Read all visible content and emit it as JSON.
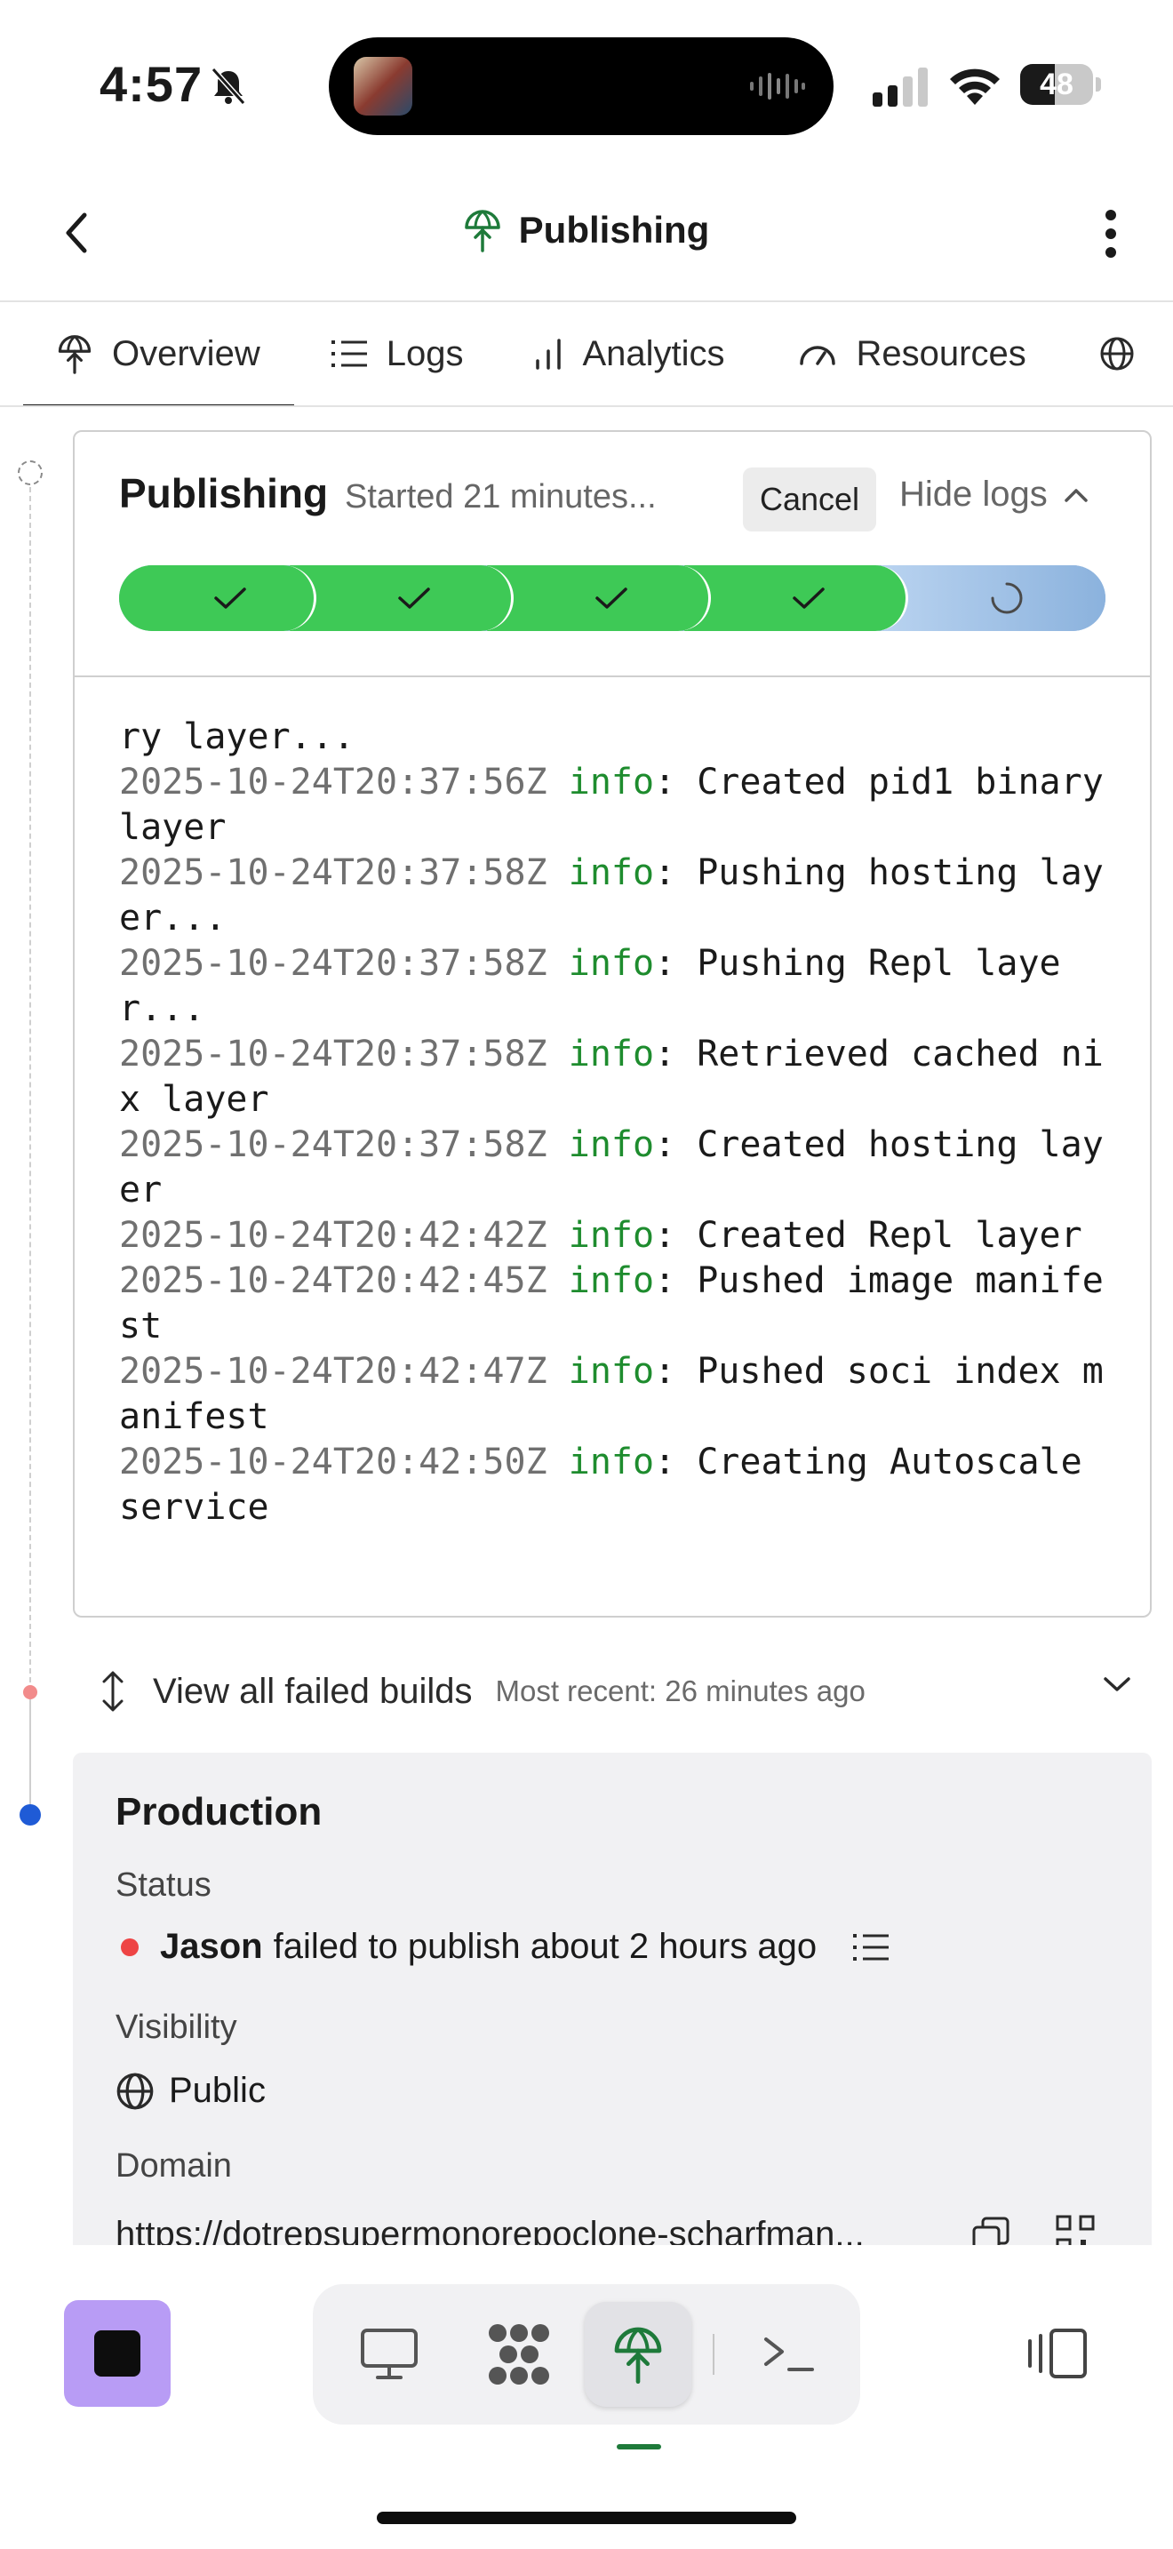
{
  "status_bar": {
    "time": "4:57",
    "battery_level": 48,
    "battery_label": "48"
  },
  "header": {
    "title": "Publishing"
  },
  "tabs": [
    {
      "label": "Overview",
      "icon": "publish-icon",
      "active": true
    },
    {
      "label": "Logs",
      "icon": "list-icon",
      "active": false
    },
    {
      "label": "Analytics",
      "icon": "bar-chart-icon",
      "active": false
    },
    {
      "label": "Resources",
      "icon": "gauge-icon",
      "active": false
    }
  ],
  "publishing": {
    "title": "Publishing",
    "started": "Started 21 minutes...",
    "cancel_label": "Cancel",
    "hide_logs_label": "Hide logs",
    "steps_completed": 4,
    "steps_total": 5
  },
  "logs": [
    {
      "ts": "",
      "level": "",
      "msg": "ry layer..."
    },
    {
      "ts": "2025-10-24T20:37:56Z",
      "level": "info",
      "msg": ": Created pid1 binary layer"
    },
    {
      "ts": "2025-10-24T20:37:58Z",
      "level": "info",
      "msg": ": Pushing hosting layer..."
    },
    {
      "ts": "2025-10-24T20:37:58Z",
      "level": "info",
      "msg": ": Pushing Repl layer..."
    },
    {
      "ts": "2025-10-24T20:37:58Z",
      "level": "info",
      "msg": ": Retrieved cached nix layer"
    },
    {
      "ts": "2025-10-24T20:37:58Z",
      "level": "info",
      "msg": ": Created hosting layer"
    },
    {
      "ts": "2025-10-24T20:42:42Z",
      "level": "info",
      "msg": ": Created Repl layer"
    },
    {
      "ts": "2025-10-24T20:42:45Z",
      "level": "info",
      "msg": ": Pushed image manifest"
    },
    {
      "ts": "2025-10-24T20:42:47Z",
      "level": "info",
      "msg": ": Pushed soci index manifest"
    },
    {
      "ts": "2025-10-24T20:42:50Z",
      "level": "info",
      "msg": ": Creating Autoscale service"
    }
  ],
  "failed_builds": {
    "label": "View all failed builds",
    "recent": "Most recent: 26 minutes ago"
  },
  "production": {
    "title": "Production",
    "status_label": "Status",
    "status_user": "Jason",
    "status_text": "failed to publish about 2 hours ago",
    "visibility_label": "Visibility",
    "visibility_value": "Public",
    "domain_label": "Domain",
    "domain_value": "https://dotrepsupermonorepoclone-scharfman..."
  },
  "colors": {
    "accent_green": "#3ec956",
    "log_info_green": "#1e8c2e",
    "stop_purple": "#b89cf5",
    "timeline_blue": "#1f5bd6",
    "error_red": "#ee4444"
  }
}
